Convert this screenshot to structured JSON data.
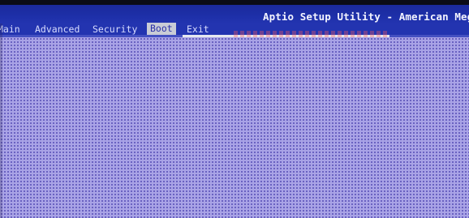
{
  "header": {
    "title": "Aptio Setup Utility - American Meg"
  },
  "menu": {
    "tabs": [
      {
        "label": "Main",
        "active": false
      },
      {
        "label": "Advanced",
        "active": false
      },
      {
        "label": "Security",
        "active": false
      },
      {
        "label": "Boot",
        "active": true
      },
      {
        "label": "Exit",
        "active": false
      }
    ]
  },
  "colors": {
    "title_bar": "#1d2fa8",
    "menu_bar": "#2334b0",
    "active_tab_bg": "#c9ccd6",
    "content_bg": "#a9a3e6"
  }
}
